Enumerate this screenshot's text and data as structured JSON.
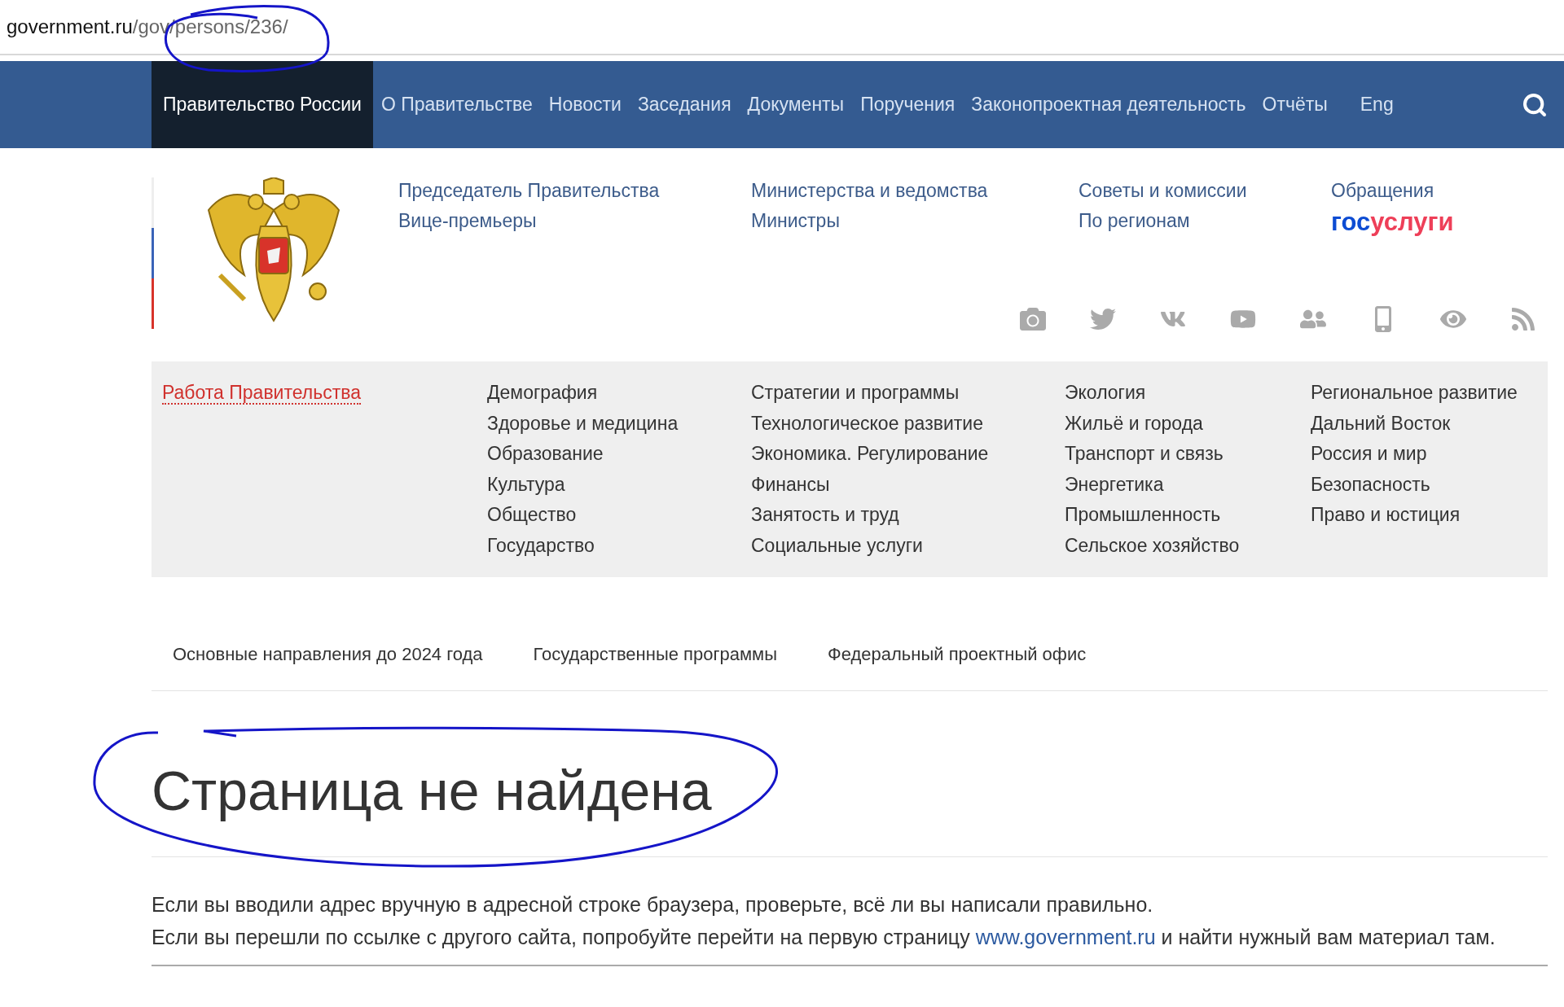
{
  "address_bar": {
    "host": "government.ru",
    "path": "/gov/persons/236/"
  },
  "nav": [
    {
      "label": "Правительство России",
      "selected": true
    },
    {
      "label": "О Правительстве",
      "selected": false
    },
    {
      "label": "Новости",
      "selected": false
    },
    {
      "label": "Заседания",
      "selected": false
    },
    {
      "label": "Документы",
      "selected": false
    },
    {
      "label": "Поручения",
      "selected": false
    },
    {
      "label": "Законопроектная деятельность",
      "selected": false
    },
    {
      "label": "Отчёты",
      "selected": false
    },
    {
      "label": "Eng",
      "selected": false
    }
  ],
  "header_links": [
    [
      "Председатель Правительства",
      "Вице-премьеры"
    ],
    [
      "Министерства и ведомства",
      "Министры"
    ],
    [
      "Советы и комиссии",
      "По регионам"
    ],
    [
      "Обращения"
    ]
  ],
  "gosuslugi_logo": {
    "part_1": "гос",
    "part_2": "услуги"
  },
  "topics": {
    "title": "Работа Правительства",
    "columns": [
      [
        "Демография",
        "Здоровье и медицина",
        "Образование",
        "Культура",
        "Общество",
        "Государство"
      ],
      [
        "Стратегии и программы",
        "Технологическое развитие",
        "Экономика. Регулирование",
        "Финансы",
        "Занятость и труд",
        "Социальные услуги"
      ],
      [
        "Экология",
        "Жильё и города",
        "Транспорт и связь",
        "Энергетика",
        "Промышленность",
        "Сельское хозяйство"
      ],
      [
        "Региональное развитие",
        "Дальний Восток",
        "Россия и мир",
        "Безопасность",
        "Право и юстиция"
      ]
    ]
  },
  "subnav": [
    "Основные направления до 2024 года",
    "Государственные программы",
    "Федеральный проектный офис"
  ],
  "heading": "Страница не найдена",
  "message": {
    "line_1": "Если вы вводили адрес вручную в адресной строке браузера, проверьте, всё ли вы написали правильно.",
    "line_2_before": "Если вы перешли по ссылке с другого сайта, попробуйте перейти на первую страницу",
    "link": "www.government.ru",
    "line_2_after": "и найти нужный вам материал там."
  }
}
